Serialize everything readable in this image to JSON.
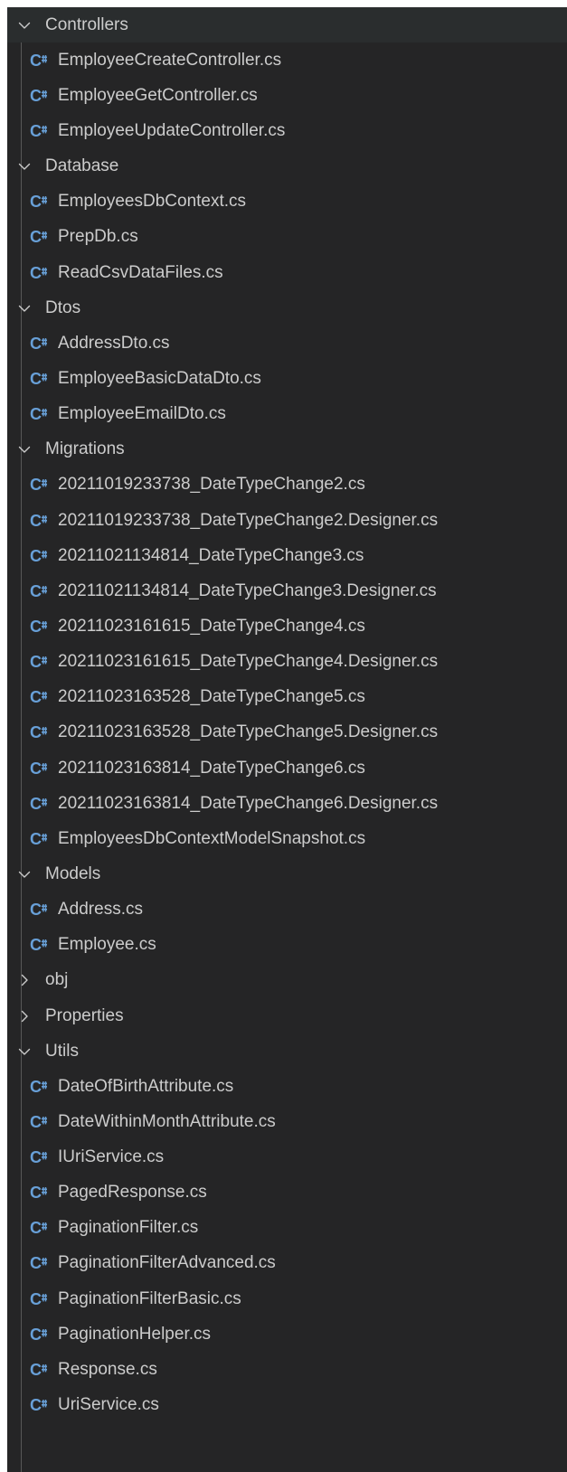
{
  "colors": {
    "background": "#252526",
    "hover_row": "#2a2d2e",
    "text": "#cccccc",
    "csharp_icon": "#68a0d8"
  },
  "icons": {
    "folder_open": "chevron-down-icon",
    "folder_closed": "chevron-right-icon",
    "file": "csharp-file-icon",
    "file_glyph": "C"
  },
  "tree": [
    {
      "type": "folder",
      "label": "Controllers",
      "expanded": true
    },
    {
      "type": "file",
      "label": "EmployeeCreateController.cs"
    },
    {
      "type": "file",
      "label": "EmployeeGetController.cs"
    },
    {
      "type": "file",
      "label": "EmployeeUpdateController.cs"
    },
    {
      "type": "folder",
      "label": "Database",
      "expanded": true
    },
    {
      "type": "file",
      "label": "EmployeesDbContext.cs"
    },
    {
      "type": "file",
      "label": "PrepDb.cs"
    },
    {
      "type": "file",
      "label": "ReadCsvDataFiles.cs"
    },
    {
      "type": "folder",
      "label": "Dtos",
      "expanded": true
    },
    {
      "type": "file",
      "label": "AddressDto.cs"
    },
    {
      "type": "file",
      "label": "EmployeeBasicDataDto.cs"
    },
    {
      "type": "file",
      "label": "EmployeeEmailDto.cs"
    },
    {
      "type": "folder",
      "label": "Migrations",
      "expanded": true
    },
    {
      "type": "file",
      "label": "20211019233738_DateTypeChange2.cs"
    },
    {
      "type": "file",
      "label": "20211019233738_DateTypeChange2.Designer.cs"
    },
    {
      "type": "file",
      "label": "20211021134814_DateTypeChange3.cs"
    },
    {
      "type": "file",
      "label": "20211021134814_DateTypeChange3.Designer.cs"
    },
    {
      "type": "file",
      "label": "20211023161615_DateTypeChange4.cs"
    },
    {
      "type": "file",
      "label": "20211023161615_DateTypeChange4.Designer.cs"
    },
    {
      "type": "file",
      "label": "20211023163528_DateTypeChange5.cs"
    },
    {
      "type": "file",
      "label": "20211023163528_DateTypeChange5.Designer.cs"
    },
    {
      "type": "file",
      "label": "20211023163814_DateTypeChange6.cs"
    },
    {
      "type": "file",
      "label": "20211023163814_DateTypeChange6.Designer.cs"
    },
    {
      "type": "file",
      "label": "EmployeesDbContextModelSnapshot.cs"
    },
    {
      "type": "folder",
      "label": "Models",
      "expanded": true
    },
    {
      "type": "file",
      "label": "Address.cs"
    },
    {
      "type": "file",
      "label": "Employee.cs"
    },
    {
      "type": "folder",
      "label": "obj",
      "expanded": false
    },
    {
      "type": "folder",
      "label": "Properties",
      "expanded": false
    },
    {
      "type": "folder",
      "label": "Utils",
      "expanded": true
    },
    {
      "type": "file",
      "label": "DateOfBirthAttribute.cs"
    },
    {
      "type": "file",
      "label": "DateWithinMonthAttribute.cs"
    },
    {
      "type": "file",
      "label": "IUriService.cs"
    },
    {
      "type": "file",
      "label": "PagedResponse.cs"
    },
    {
      "type": "file",
      "label": "PaginationFilter.cs"
    },
    {
      "type": "file",
      "label": "PaginationFilterAdvanced.cs"
    },
    {
      "type": "file",
      "label": "PaginationFilterBasic.cs"
    },
    {
      "type": "file",
      "label": "PaginationHelper.cs"
    },
    {
      "type": "file",
      "label": "Response.cs"
    },
    {
      "type": "file",
      "label": "UriService.cs"
    }
  ]
}
